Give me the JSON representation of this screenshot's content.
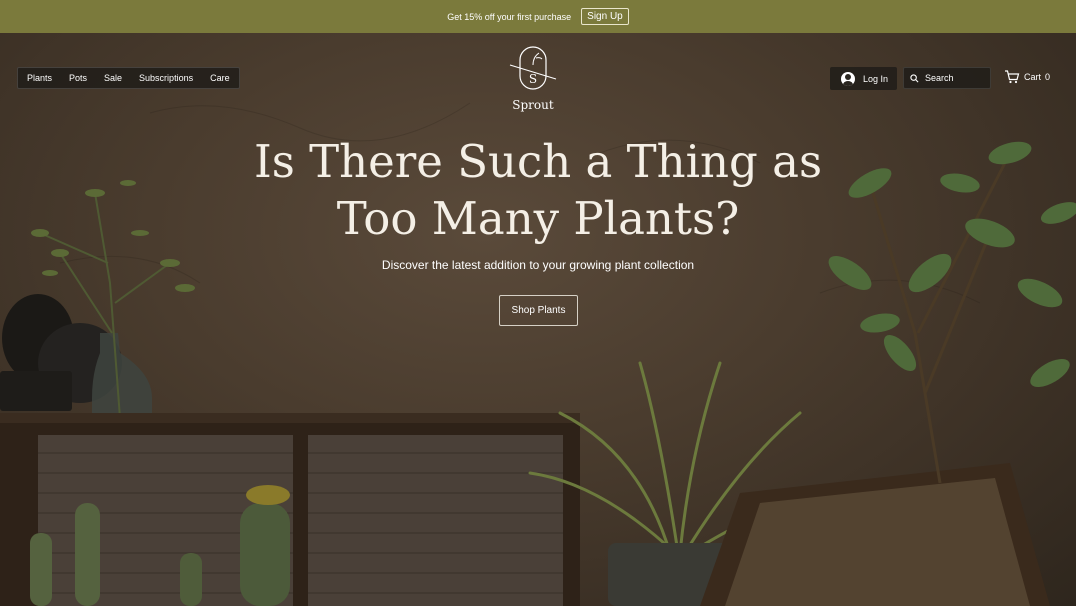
{
  "announcement": {
    "text": "Get 15% off your first purchase",
    "cta": "Sign Up"
  },
  "nav": {
    "items": [
      "Plants",
      "Pots",
      "Sale",
      "Subscriptions",
      "Care"
    ]
  },
  "logo": {
    "monogram": "S",
    "name": "Sprout"
  },
  "header": {
    "login_label": "Log In",
    "search_placeholder": "Search",
    "cart_label": "Cart",
    "cart_count": "0"
  },
  "hero": {
    "headline_line1": "Is There Such a Thing as",
    "headline_line2": "Too Many Plants?",
    "subheadline": "Discover the latest addition to your growing plant collection",
    "cta": "Shop Plants"
  },
  "colors": {
    "announcement_bg": "#7b7a3c",
    "hero_bg": "#4a3c2e",
    "text": "#ffffff"
  },
  "icons": [
    "user-icon",
    "search-icon",
    "cart-icon"
  ]
}
